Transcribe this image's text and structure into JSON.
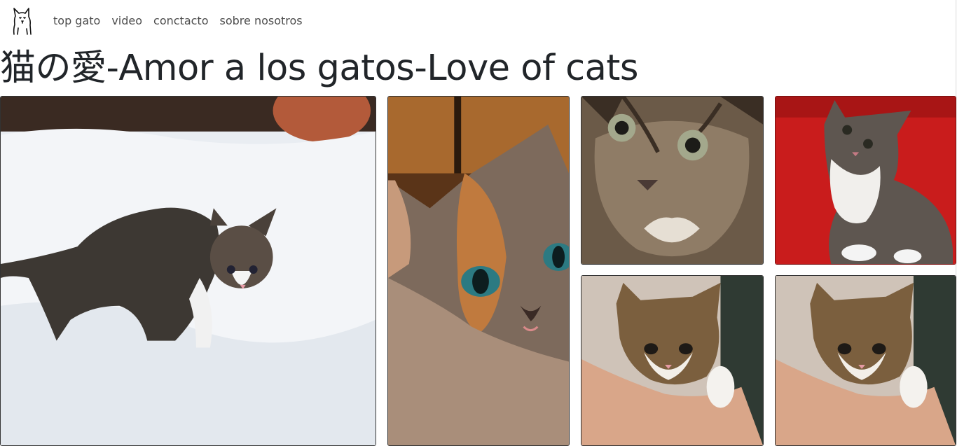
{
  "nav": {
    "logo_icon": "cat-icon",
    "links": [
      "top gato",
      "video",
      "conctacto",
      "sobre nosotros"
    ]
  },
  "title": "猫の愛-Amor a los gatos-Love of cats",
  "gallery": [
    {
      "subject": "tabby kitten walking in snow"
    },
    {
      "subject": "calico kitten close-up"
    },
    {
      "subject": "tabby kitten face close-up"
    },
    {
      "subject": "tabby kitten on red background"
    },
    {
      "subject": "kitten held in a hand"
    },
    {
      "subject": "kitten held in a hand"
    }
  ]
}
